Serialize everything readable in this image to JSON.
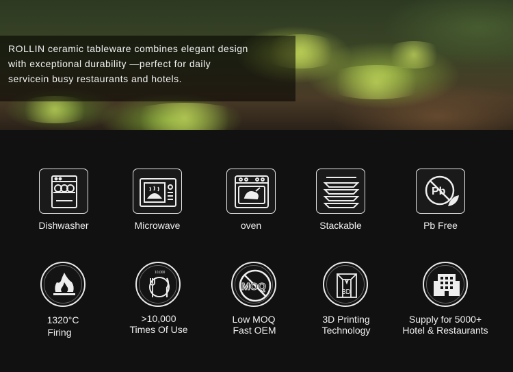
{
  "hero": {
    "lines": [
      "ROLLIN ceramic tableware combines elegant design",
      "with exceptional durability —perfect for daily",
      "servicein busy restaurants and hotels."
    ]
  },
  "features_row1": [
    {
      "icon": "dishwasher-icon",
      "label": "Dishwasher"
    },
    {
      "icon": "microwave-icon",
      "label": "Microwave"
    },
    {
      "icon": "oven-icon",
      "label": "oven"
    },
    {
      "icon": "stackable-plates-icon",
      "label": "Stackable"
    },
    {
      "icon": "lead-free-icon",
      "label": "Pb Free"
    }
  ],
  "features_row2": [
    {
      "icon": "fire-icon",
      "label1": "1320°C",
      "label2": "Firing"
    },
    {
      "icon": "plate-fork-knife-icon",
      "badge": "10,000",
      "label1": ">10,000",
      "label2": "Times Of Use"
    },
    {
      "icon": "no-moq-icon",
      "badge": "MOQ",
      "label1": "Low MOQ",
      "label2": "Fast OEM"
    },
    {
      "icon": "3d-printing-icon",
      "badge": "3D",
      "label1": "3D Printing",
      "label2": "Technology"
    },
    {
      "icon": "hotel-building-icon",
      "label1": "Supply for 5000+",
      "label2": "Hotel & Restaurants"
    }
  ]
}
